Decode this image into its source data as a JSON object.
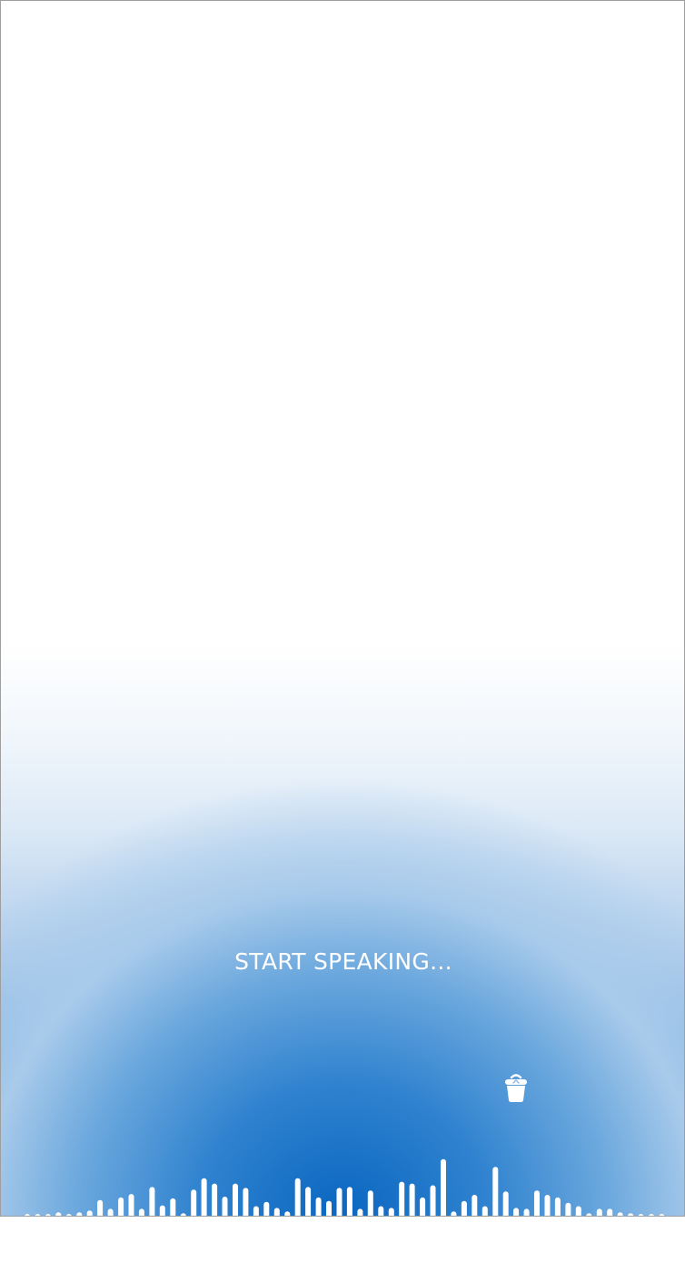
{
  "screen": {
    "prompt_text": "START SPEAKING...",
    "accent_color": "#0a66c0",
    "background_color": "#ffffff"
  },
  "controls": {
    "trash_icon": "trash-icon"
  },
  "waveform": {
    "bar_color": "#ffffff",
    "levels": [
      0.04,
      0.04,
      0.04,
      0.06,
      0.04,
      0.06,
      0.08,
      0.2,
      0.1,
      0.23,
      0.27,
      0.1,
      0.35,
      0.14,
      0.22,
      0.05,
      0.32,
      0.45,
      0.39,
      0.24,
      0.39,
      0.34,
      0.13,
      0.18,
      0.11,
      0.07,
      0.45,
      0.35,
      0.23,
      0.19,
      0.34,
      0.35,
      0.1,
      0.31,
      0.13,
      0.11,
      0.41,
      0.39,
      0.23,
      0.37,
      0.67,
      0.07,
      0.19,
      0.26,
      0.13,
      0.58,
      0.3,
      0.11,
      0.1,
      0.31,
      0.26,
      0.23,
      0.17,
      0.13,
      0.05,
      0.1,
      0.1,
      0.06,
      0.05,
      0.04,
      0.04,
      0.04
    ]
  }
}
